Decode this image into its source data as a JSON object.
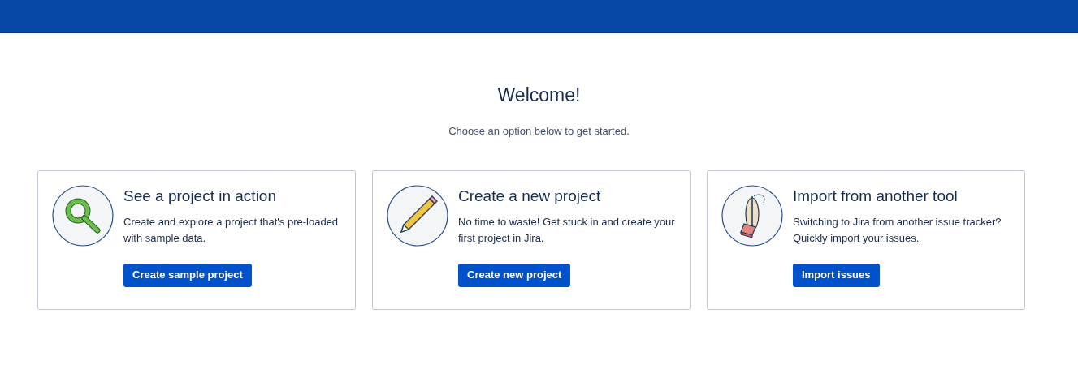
{
  "heading": "Welcome!",
  "subtitle": "Choose an option below to get started.",
  "cards": [
    {
      "kind": "magnifier",
      "title": "See a project in action",
      "description": "Create and explore a project that's pre-loaded with sample data.",
      "button": "Create sample project"
    },
    {
      "kind": "pencil",
      "title": "Create a new project",
      "description": "No time to waste! Get stuck in and create your first project in Jira.",
      "button": "Create new project"
    },
    {
      "kind": "vacuum",
      "title": "Import from another tool",
      "description": "Switching to Jira from another issue tracker? Quickly import your issues.",
      "button": "Import issues"
    }
  ]
}
